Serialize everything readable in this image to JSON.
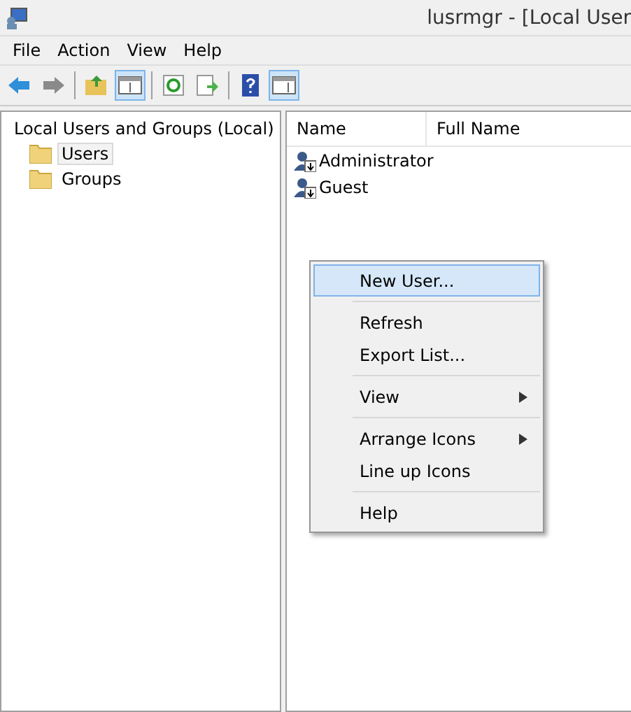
{
  "window": {
    "title": "lusrmgr - [Local User"
  },
  "menu_bar": [
    "File",
    "Action",
    "View",
    "Help"
  ],
  "toolbar": [
    [
      {
        "kind": "back",
        "pressed": false
      },
      {
        "kind": "forward",
        "pressed": false
      }
    ],
    [
      {
        "kind": "up",
        "pressed": false
      },
      {
        "kind": "tree",
        "pressed": true
      }
    ],
    [
      {
        "kind": "refresh",
        "pressed": false
      },
      {
        "kind": "export",
        "pressed": false
      }
    ],
    [
      {
        "kind": "help",
        "pressed": false
      },
      {
        "kind": "actionpane",
        "pressed": true
      }
    ]
  ],
  "tree": {
    "label": "Local Users and Groups (Local)",
    "selected": false,
    "children": [
      {
        "label": "Users",
        "selected": true
      },
      {
        "label": "Groups",
        "selected": false
      }
    ]
  },
  "table": {
    "columns": [
      "Name",
      "Full Name"
    ],
    "rows": [
      "Administrator",
      "Guest"
    ]
  },
  "context_menu": {
    "groups": [
      [
        {
          "label": "New User...",
          "selected": true,
          "submenu": false
        }
      ],
      [
        {
          "label": "Refresh",
          "selected": false,
          "submenu": false
        },
        {
          "label": "Export List...",
          "selected": false,
          "submenu": false
        }
      ],
      [
        {
          "label": "View",
          "selected": false,
          "submenu": true
        }
      ],
      [
        {
          "label": "Arrange Icons",
          "selected": false,
          "submenu": true
        },
        {
          "label": "Line up Icons",
          "selected": false,
          "submenu": false
        }
      ],
      [
        {
          "label": "Help",
          "selected": false,
          "submenu": false
        }
      ]
    ]
  }
}
